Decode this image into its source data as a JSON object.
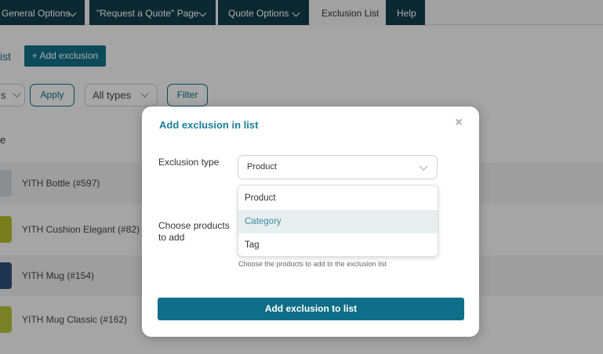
{
  "tabs": [
    {
      "label": "General Options"
    },
    {
      "label": "\"Request a Quote\" Page"
    },
    {
      "label": "Quote Options"
    },
    {
      "label": "Exclusion List"
    },
    {
      "label": "Help"
    }
  ],
  "page": {
    "heading_fragment": "ist",
    "add_exclusion_label": "+ Add exclusion",
    "bulk_select_fragment": "s",
    "apply_label": "Apply",
    "types_select_value": "All types",
    "filter_label": "Filter",
    "column_header_fragment": "e",
    "rows": [
      {
        "name": "YITH Bottle (#597)",
        "thumb_color": "#cfd2d4"
      },
      {
        "name": "YITH Cushion Elegant (#82)",
        "thumb_color": "#b5bd2a"
      },
      {
        "name": "YITH Mug (#154)",
        "thumb_color": "#2f4f7a"
      },
      {
        "name": "YITH Mug Classic (#162)",
        "thumb_color": "#b8c13a"
      }
    ]
  },
  "modal": {
    "title": "Add exclusion in list",
    "close_symbol": "×",
    "exclusion_type_label": "Exclusion type",
    "exclusion_type_value": "Product",
    "options": [
      {
        "label": "Product"
      },
      {
        "label": "Category"
      },
      {
        "label": "Tag"
      }
    ],
    "choose_products_label": "Choose products to add",
    "helper_text": "Choose the products to add to the exclusion list",
    "submit_label": "Add exclusion to list"
  },
  "colors": {
    "brand_teal": "#0f6f88",
    "tab_dark": "#123d4a",
    "title_teal": "#1a7f98",
    "highlight_bg": "#e7eef0"
  }
}
